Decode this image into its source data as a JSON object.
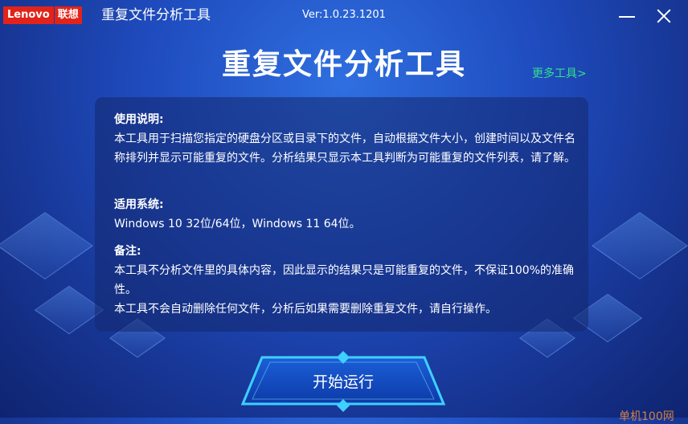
{
  "titlebar": {
    "logo_en": "Lenovo",
    "logo_cn": "联想",
    "app_title": "重复文件分析工具",
    "version": "Ver:1.0.23.1201"
  },
  "main": {
    "heading": "重复文件分析工具",
    "more_tools": "更多工具>",
    "usage_title": "使用说明:",
    "usage_text": "本工具用于扫描您指定的硬盘分区或目录下的文件，自动根据文件大小，创建时间以及文件名称排列并显示可能重复的文件。分析结果只显示本工具判断为可能重复的文件列表，请了解。",
    "system_title": "适用系统:",
    "system_text": "Windows 10 32位/64位，Windows 11 64位。",
    "note_title": "备注:",
    "note_text_1": "本工具不分析文件里的具体内容，因此显示的结果只是可能重复的文件，不保证100%的准确性。",
    "note_text_2": "本工具不会自动删除任何文件，分析后如果需要删除重复文件，请自行操作。",
    "start_button": "开始运行"
  },
  "watermark": "单机100网",
  "colors": {
    "brand_red": "#e2231a",
    "link_green": "#33e08a",
    "button_glow": "#3fd0ff"
  }
}
